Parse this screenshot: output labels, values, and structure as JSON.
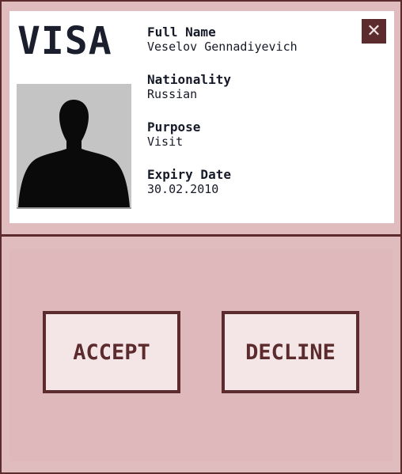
{
  "visa": {
    "title": "VISA",
    "close_symbol": "✕",
    "fields": [
      {
        "label": "Full Name",
        "value": "Veselov Gennadiyevich"
      },
      {
        "label": "Nationality",
        "value": "Russian"
      },
      {
        "label": "Purpose",
        "value": "Visit"
      },
      {
        "label": "Expiry Date",
        "value": "30.02.2010"
      }
    ]
  },
  "actions": {
    "accept_label": "ACCEPT",
    "decline_label": "DECLINE"
  },
  "icons": {
    "close": "close-icon",
    "photo": "person-silhouette-icon"
  },
  "colors": {
    "frame_bg": "#e1bcbf",
    "accent": "#5c2b2e",
    "button_bg": "#f4e5e6",
    "text": "#161a28"
  }
}
